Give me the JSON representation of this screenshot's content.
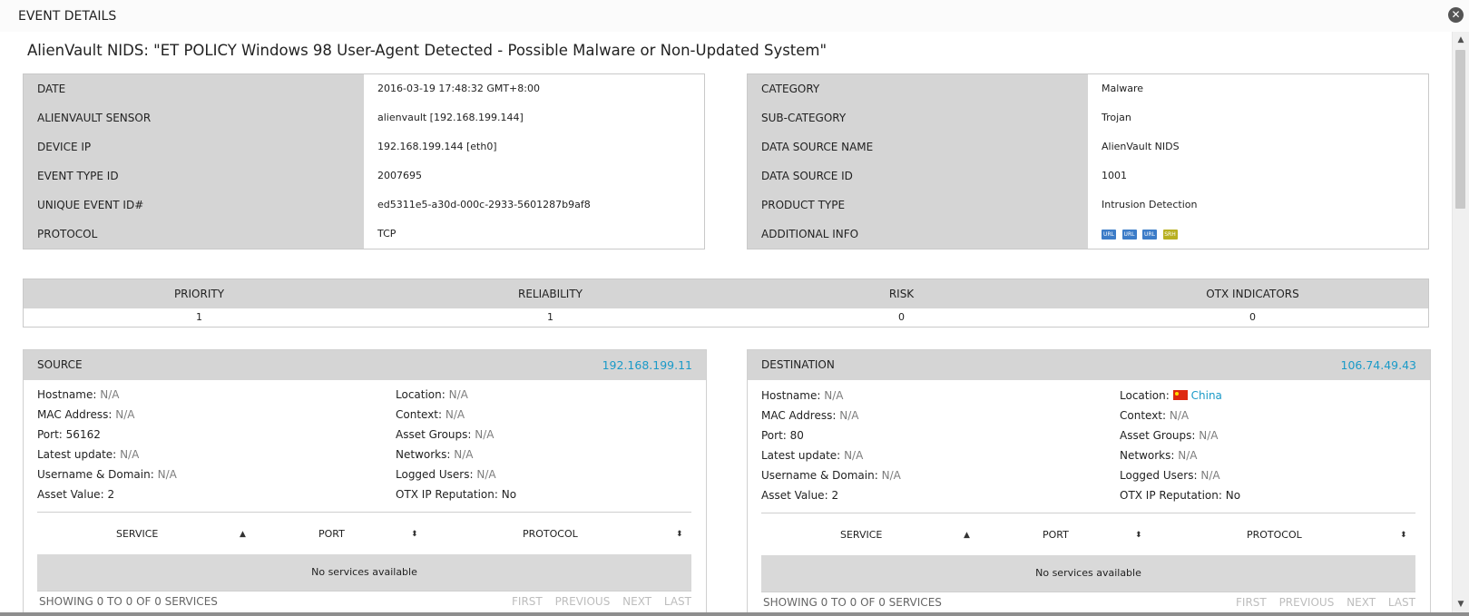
{
  "header": {
    "title": "EVENT DETAILS",
    "close_glyph": "✕"
  },
  "event": {
    "title": "AlienVault NIDS: \"ET POLICY Windows 98 User-Agent Detected - Possible Malware or Non-Updated System\""
  },
  "left_details": [
    {
      "key": "DATE",
      "value": "2016-03-19 17:48:32 GMT+8:00"
    },
    {
      "key": "ALIENVAULT SENSOR",
      "value": "alienvault [192.168.199.144]"
    },
    {
      "key": "DEVICE IP",
      "value": "192.168.199.144 [eth0]"
    },
    {
      "key": "EVENT TYPE ID",
      "value": "2007695"
    },
    {
      "key": "UNIQUE EVENT ID#",
      "value": "ed5311e5-a30d-000c-2933-5601287b9af8"
    },
    {
      "key": "PROTOCOL",
      "value": "TCP"
    }
  ],
  "right_details": [
    {
      "key": "CATEGORY",
      "value": "Malware"
    },
    {
      "key": "SUB-CATEGORY",
      "value": "Trojan"
    },
    {
      "key": "DATA SOURCE NAME",
      "value": "AlienVault NIDS"
    },
    {
      "key": "DATA SOURCE ID",
      "value": "1001"
    },
    {
      "key": "PRODUCT TYPE",
      "value": "Intrusion Detection"
    },
    {
      "key": "ADDITIONAL INFO",
      "value": ""
    }
  ],
  "additional_info_badges": [
    {
      "label": "URL",
      "color": "#3c7cc8"
    },
    {
      "label": "URL",
      "color": "#3c7cc8"
    },
    {
      "label": "URL",
      "color": "#3c7cc8"
    },
    {
      "label": "SRH",
      "color": "#b8b020"
    }
  ],
  "metrics": {
    "headers": [
      "PRIORITY",
      "RELIABILITY",
      "RISK",
      "OTX INDICATORS"
    ],
    "values": [
      "1",
      "1",
      "0",
      "0"
    ]
  },
  "source": {
    "title": "SOURCE",
    "ip": "192.168.199.11",
    "hostname_label": "Hostname:",
    "hostname": "N/A",
    "mac_label": "MAC Address:",
    "mac": "N/A",
    "port_label": "Port:",
    "port": "56162",
    "latest_label": "Latest update:",
    "latest": "N/A",
    "user_label": "Username & Domain:",
    "user": "N/A",
    "asset_label": "Asset Value:",
    "asset": "2",
    "location_label": "Location:",
    "location": "N/A",
    "context_label": "Context:",
    "context": "N/A",
    "groups_label": "Asset Groups:",
    "groups": "N/A",
    "networks_label": "Networks:",
    "networks": "N/A",
    "logged_label": "Logged Users:",
    "logged": "N/A",
    "otx_label": "OTX IP Reputation:",
    "otx": "No",
    "services": {
      "headers": [
        "SERVICE",
        "PORT",
        "PROTOCOL"
      ],
      "empty": "No services available",
      "count": "SHOWING 0 TO 0 OF 0 SERVICES",
      "pager": [
        "FIRST",
        "PREVIOUS",
        "NEXT",
        "LAST"
      ]
    }
  },
  "destination": {
    "title": "DESTINATION",
    "ip": "106.74.49.43",
    "hostname_label": "Hostname:",
    "hostname": "N/A",
    "mac_label": "MAC Address:",
    "mac": "N/A",
    "port_label": "Port:",
    "port": "80",
    "latest_label": "Latest update:",
    "latest": "N/A",
    "user_label": "Username & Domain:",
    "user": "N/A",
    "asset_label": "Asset Value:",
    "asset": "2",
    "location_label": "Location:",
    "location": "China",
    "location_flag": "china-flag-icon",
    "context_label": "Context:",
    "context": "N/A",
    "groups_label": "Asset Groups:",
    "groups": "N/A",
    "networks_label": "Networks:",
    "networks": "N/A",
    "logged_label": "Logged Users:",
    "logged": "N/A",
    "otx_label": "OTX IP Reputation:",
    "otx": "No",
    "services": {
      "headers": [
        "SERVICE",
        "PORT",
        "PROTOCOL"
      ],
      "empty": "No services available",
      "count": "SHOWING 0 TO 0 OF 0 SERVICES",
      "pager": [
        "FIRST",
        "PREVIOUS",
        "NEXT",
        "LAST"
      ]
    }
  },
  "colors": {
    "link": "#1a9ac8",
    "header_bg": "#d5d5d5"
  }
}
